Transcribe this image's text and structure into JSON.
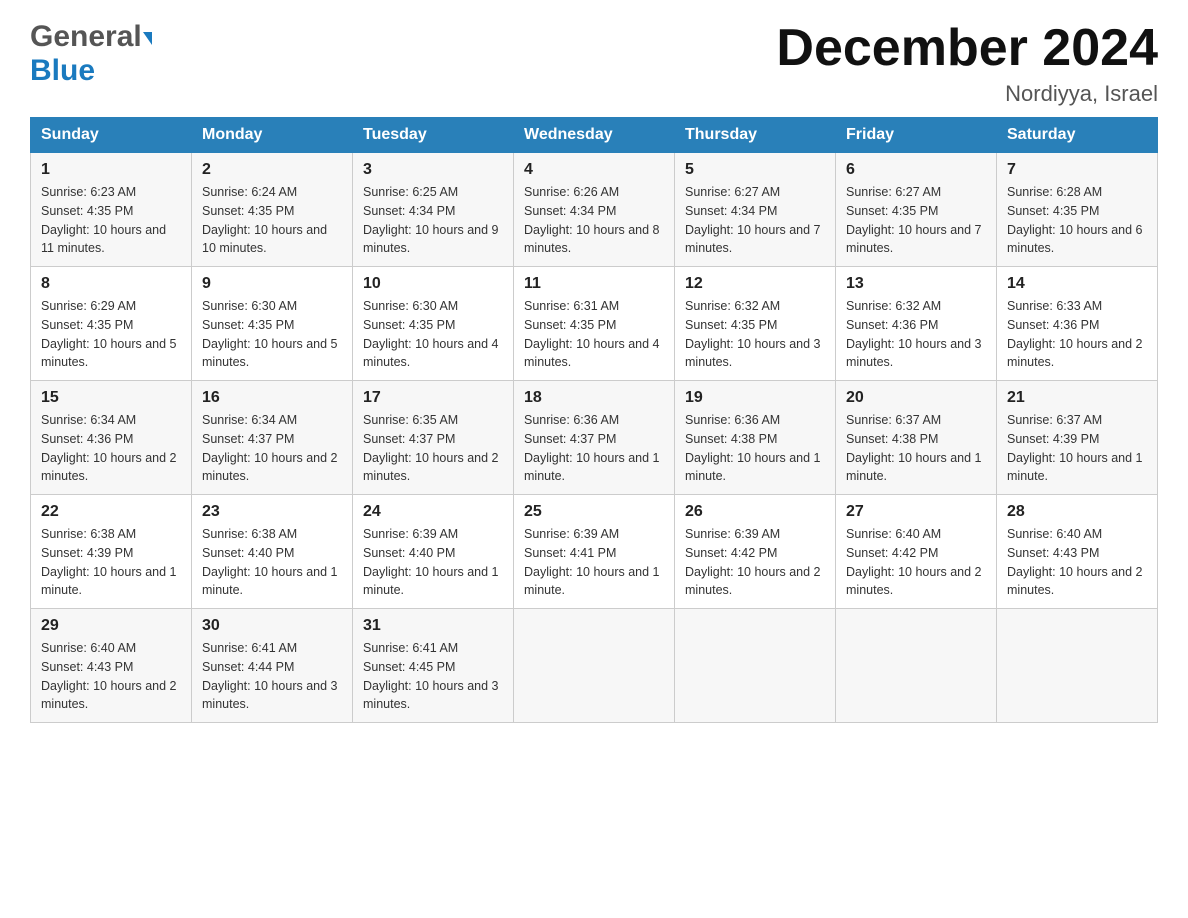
{
  "header": {
    "logo_general": "General",
    "logo_blue": "Blue",
    "month_title": "December 2024",
    "location": "Nordiyya, Israel"
  },
  "weekdays": [
    "Sunday",
    "Monday",
    "Tuesday",
    "Wednesday",
    "Thursday",
    "Friday",
    "Saturday"
  ],
  "weeks": [
    [
      {
        "day": "1",
        "sunrise": "6:23 AM",
        "sunset": "4:35 PM",
        "daylight": "10 hours and 11 minutes."
      },
      {
        "day": "2",
        "sunrise": "6:24 AM",
        "sunset": "4:35 PM",
        "daylight": "10 hours and 10 minutes."
      },
      {
        "day": "3",
        "sunrise": "6:25 AM",
        "sunset": "4:34 PM",
        "daylight": "10 hours and 9 minutes."
      },
      {
        "day": "4",
        "sunrise": "6:26 AM",
        "sunset": "4:34 PM",
        "daylight": "10 hours and 8 minutes."
      },
      {
        "day": "5",
        "sunrise": "6:27 AM",
        "sunset": "4:34 PM",
        "daylight": "10 hours and 7 minutes."
      },
      {
        "day": "6",
        "sunrise": "6:27 AM",
        "sunset": "4:35 PM",
        "daylight": "10 hours and 7 minutes."
      },
      {
        "day": "7",
        "sunrise": "6:28 AM",
        "sunset": "4:35 PM",
        "daylight": "10 hours and 6 minutes."
      }
    ],
    [
      {
        "day": "8",
        "sunrise": "6:29 AM",
        "sunset": "4:35 PM",
        "daylight": "10 hours and 5 minutes."
      },
      {
        "day": "9",
        "sunrise": "6:30 AM",
        "sunset": "4:35 PM",
        "daylight": "10 hours and 5 minutes."
      },
      {
        "day": "10",
        "sunrise": "6:30 AM",
        "sunset": "4:35 PM",
        "daylight": "10 hours and 4 minutes."
      },
      {
        "day": "11",
        "sunrise": "6:31 AM",
        "sunset": "4:35 PM",
        "daylight": "10 hours and 4 minutes."
      },
      {
        "day": "12",
        "sunrise": "6:32 AM",
        "sunset": "4:35 PM",
        "daylight": "10 hours and 3 minutes."
      },
      {
        "day": "13",
        "sunrise": "6:32 AM",
        "sunset": "4:36 PM",
        "daylight": "10 hours and 3 minutes."
      },
      {
        "day": "14",
        "sunrise": "6:33 AM",
        "sunset": "4:36 PM",
        "daylight": "10 hours and 2 minutes."
      }
    ],
    [
      {
        "day": "15",
        "sunrise": "6:34 AM",
        "sunset": "4:36 PM",
        "daylight": "10 hours and 2 minutes."
      },
      {
        "day": "16",
        "sunrise": "6:34 AM",
        "sunset": "4:37 PM",
        "daylight": "10 hours and 2 minutes."
      },
      {
        "day": "17",
        "sunrise": "6:35 AM",
        "sunset": "4:37 PM",
        "daylight": "10 hours and 2 minutes."
      },
      {
        "day": "18",
        "sunrise": "6:36 AM",
        "sunset": "4:37 PM",
        "daylight": "10 hours and 1 minute."
      },
      {
        "day": "19",
        "sunrise": "6:36 AM",
        "sunset": "4:38 PM",
        "daylight": "10 hours and 1 minute."
      },
      {
        "day": "20",
        "sunrise": "6:37 AM",
        "sunset": "4:38 PM",
        "daylight": "10 hours and 1 minute."
      },
      {
        "day": "21",
        "sunrise": "6:37 AM",
        "sunset": "4:39 PM",
        "daylight": "10 hours and 1 minute."
      }
    ],
    [
      {
        "day": "22",
        "sunrise": "6:38 AM",
        "sunset": "4:39 PM",
        "daylight": "10 hours and 1 minute."
      },
      {
        "day": "23",
        "sunrise": "6:38 AM",
        "sunset": "4:40 PM",
        "daylight": "10 hours and 1 minute."
      },
      {
        "day": "24",
        "sunrise": "6:39 AM",
        "sunset": "4:40 PM",
        "daylight": "10 hours and 1 minute."
      },
      {
        "day": "25",
        "sunrise": "6:39 AM",
        "sunset": "4:41 PM",
        "daylight": "10 hours and 1 minute."
      },
      {
        "day": "26",
        "sunrise": "6:39 AM",
        "sunset": "4:42 PM",
        "daylight": "10 hours and 2 minutes."
      },
      {
        "day": "27",
        "sunrise": "6:40 AM",
        "sunset": "4:42 PM",
        "daylight": "10 hours and 2 minutes."
      },
      {
        "day": "28",
        "sunrise": "6:40 AM",
        "sunset": "4:43 PM",
        "daylight": "10 hours and 2 minutes."
      }
    ],
    [
      {
        "day": "29",
        "sunrise": "6:40 AM",
        "sunset": "4:43 PM",
        "daylight": "10 hours and 2 minutes."
      },
      {
        "day": "30",
        "sunrise": "6:41 AM",
        "sunset": "4:44 PM",
        "daylight": "10 hours and 3 minutes."
      },
      {
        "day": "31",
        "sunrise": "6:41 AM",
        "sunset": "4:45 PM",
        "daylight": "10 hours and 3 minutes."
      },
      null,
      null,
      null,
      null
    ]
  ],
  "labels": {
    "sunrise": "Sunrise:",
    "sunset": "Sunset:",
    "daylight": "Daylight:"
  }
}
